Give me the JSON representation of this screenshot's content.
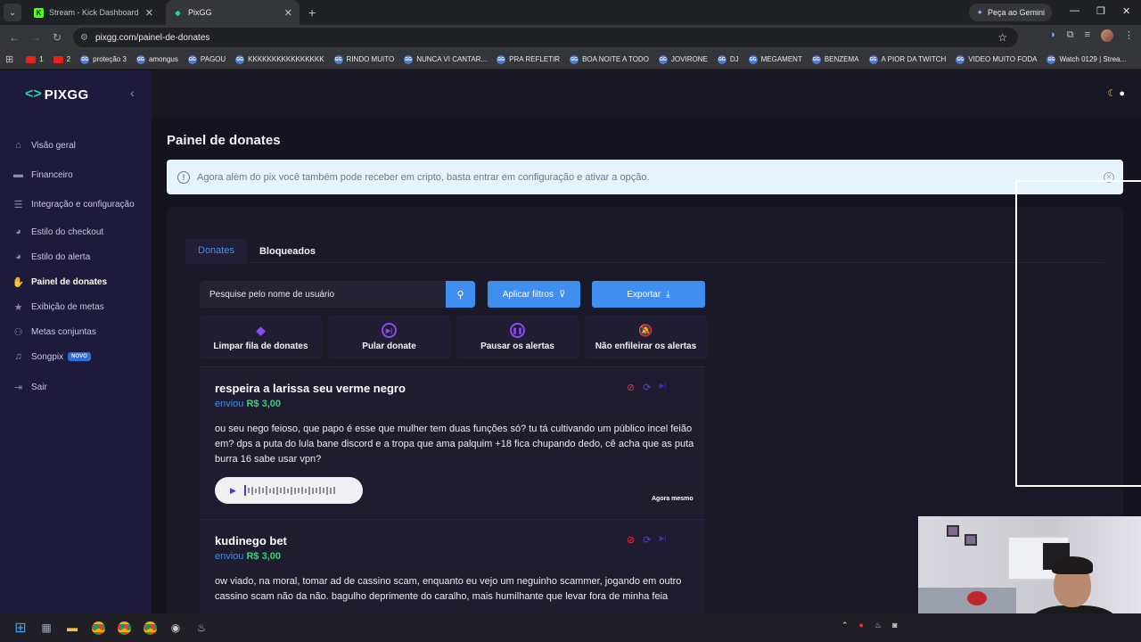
{
  "browser": {
    "tabs": [
      {
        "title": "Stream - Kick Dashboard",
        "fav": "K",
        "active": false
      },
      {
        "title": "PixGG",
        "fav": "◆",
        "active": true
      }
    ],
    "gemini_label": "Peça ao Gemini",
    "url": "pixgg.com/painel-de-donates",
    "bookmarks": [
      "1",
      "2",
      "proteção 3",
      "amongus",
      "PAGOU",
      "KKKKKKKKKKKKKKKK",
      "RINDO MUITO",
      "NUNCA VI CANTAR...",
      "PRA REFLETIR",
      "BOA NOITE A TODO",
      "JOVIRONE",
      "DJ",
      "MEGAMENT",
      "BENZEMA",
      "A PIOR DA TWITCH",
      "VIDEO MUITO FODA",
      "Watch 0129 | Strea..."
    ]
  },
  "app": {
    "brand": "PIXGG",
    "nav": [
      {
        "label": "Visão geral",
        "icon": "home-icon",
        "glyph": "⌂",
        "active": false
      },
      {
        "label": "Financeiro",
        "icon": "wallet-icon",
        "glyph": "▬",
        "active": false
      },
      {
        "label": "Integração e configuração",
        "icon": "settings-doc-icon",
        "glyph": "☰",
        "active": false
      },
      {
        "label": "Estilo do checkout",
        "icon": "palette-icon",
        "glyph": "◕",
        "active": false
      },
      {
        "label": "Estilo do alerta",
        "icon": "palette-icon",
        "glyph": "◕",
        "active": false
      },
      {
        "label": "Painel de donates",
        "icon": "hand-money-icon",
        "glyph": "✋",
        "active": true
      },
      {
        "label": "Exibição de metas",
        "icon": "star-icon",
        "glyph": "★",
        "active": false
      },
      {
        "label": "Metas conjuntas",
        "icon": "users-icon",
        "glyph": "👥",
        "active": false
      },
      {
        "label": "Songpix",
        "icon": "music-icon",
        "glyph": "♫",
        "active": false,
        "badge": "NOVO"
      },
      {
        "label": "Sair",
        "icon": "logout-icon",
        "glyph": "⇥",
        "active": false
      }
    ]
  },
  "page": {
    "title": "Painel de donates",
    "info": "Agora além do pix você também pode receber em cripto, basta entrar em configuração e ativar a opção.",
    "tabs": [
      "Donates",
      "Bloqueados"
    ],
    "search_placeholder": "Pesquise pelo nome de usuário",
    "filter_label": "Aplicar filtros",
    "export_label": "Exportar",
    "actions": [
      {
        "label": "Limpar fila de donates",
        "icon": "eraser-icon"
      },
      {
        "label": "Pular donate",
        "icon": "skip-icon"
      },
      {
        "label": "Pausar os alertas",
        "icon": "pause-icon"
      },
      {
        "label": "Não enfileirar os alertas",
        "icon": "bell-off-icon"
      }
    ],
    "donates": [
      {
        "name": "respeira a larissa seu verme negro",
        "sent_label": "enviou",
        "amount": "R$ 3,00",
        "message": "ou seu nego feioso, que papo é esse que mulher tem duas funções só? tu tá cultivando um público incel feião em? dps a puta do lula bane discord e a tropa que ama palquim +18 fica chupando dedo, cê acha que as puta burra 16 sabe usar vpn?",
        "time": "Agora mesmo",
        "has_audio": true
      },
      {
        "name": "kudinego bet",
        "sent_label": "enviou",
        "amount": "R$ 3,00",
        "message": "ow viado, na moral, tomar ad de cassino scam, enquanto eu vejo um neguinho scammer, jogando em outro cassino scam não da não. bagulho deprimente do caralho, mais humilhante que levar fora de minha feia",
        "time": "",
        "has_audio": false
      }
    ]
  },
  "colors": {
    "accent": "#3f8ef0",
    "sidebar": "#1d1a3b",
    "amount": "#2ed66f",
    "action_icon": "#8a4af3"
  }
}
